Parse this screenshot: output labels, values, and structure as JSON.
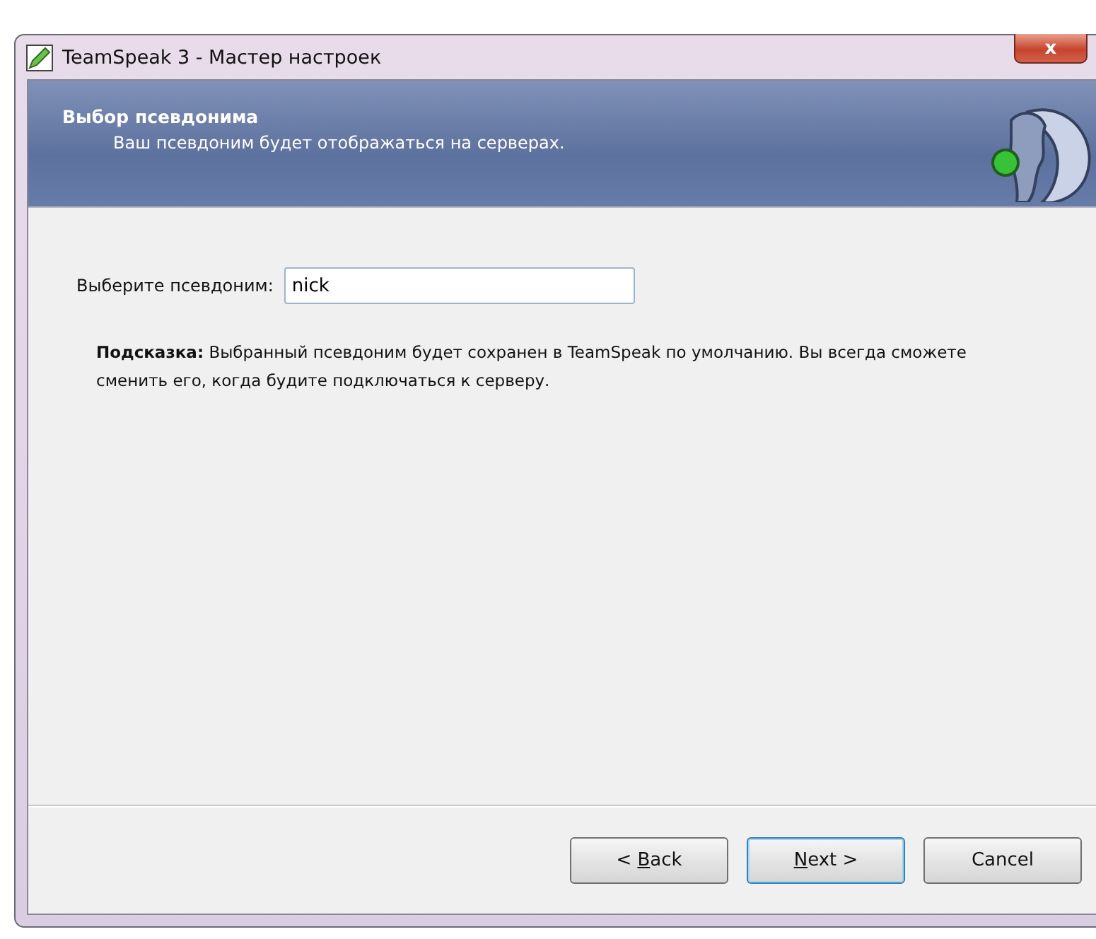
{
  "window": {
    "title": "TeamSpeak 3 - Мастер настроек",
    "close": "x"
  },
  "header": {
    "title": "Выбор псевдонима",
    "subtitle": "Ваш псевдоним будет отображаться на серверах."
  },
  "nickname": {
    "label": "Выберите псевдоним:",
    "value": "nick"
  },
  "hint": "**Подсказка:** Выбранный псевдоним будет сохранен в TeamSpeak по умолчанию. Вы всегда сможете сменить его, когда будите подключаться к серверу.",
  "buttons": [
    {
      "before": "< ",
      "key": "B",
      "after": "ack",
      "default": false
    },
    {
      "key": "N",
      "after": "ext >",
      "default": true
    },
    {
      "before": "Cancel",
      "default": false
    }
  ]
}
